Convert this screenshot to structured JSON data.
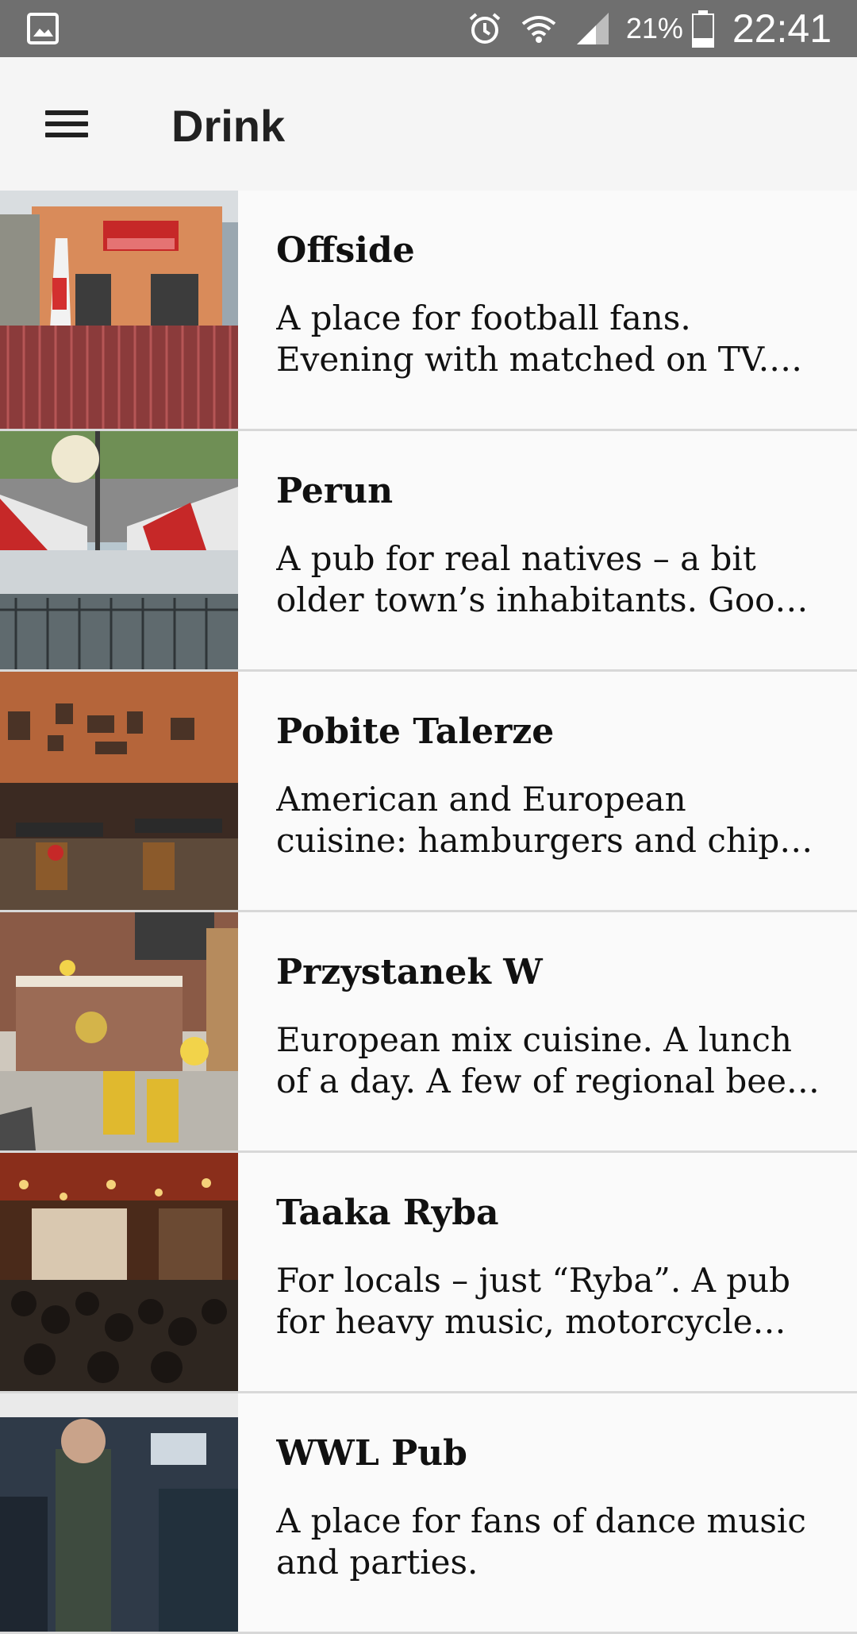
{
  "status_bar": {
    "gallery_icon": "image-icon",
    "alarm_icon": "alarm-clock-icon",
    "wifi_icon": "wifi-icon",
    "signal_icon": "cell-signal-icon",
    "battery_percent": "21%",
    "battery_icon": "battery-icon",
    "time": "22:41"
  },
  "app_bar": {
    "menu_icon": "hamburger-menu-icon",
    "title": "Drink"
  },
  "list": {
    "items": [
      {
        "title": "Offside",
        "description": "A place for football fans. Evening with matched on TV. Live sport events and cold beer."
      },
      {
        "title": "Perun",
        "description": "A pub for real natives – a bit older town’s inhabitants. Good beer and friendly atmosphere."
      },
      {
        "title": "Pobite Talerze",
        "description": "American and European cuisine: hamburgers and chips, steaks and salads."
      },
      {
        "title": "Przystanek W",
        "description": "European mix cuisine. A lunch of a day. A few of regional beers on tap."
      },
      {
        "title": "Taaka Ryba",
        "description": "For locals – just “Ryba”. A pub for heavy music, motorcycle fans and concerts."
      },
      {
        "title": "WWL Pub",
        "description": "A place for fans of dance music and parties."
      }
    ]
  },
  "colors": {
    "status_bar_bg": "#6f6f6f",
    "app_bar_bg": "#f5f5f5",
    "list_bg": "#fafafa",
    "divider": "#d8d8d8",
    "text": "#111111"
  }
}
